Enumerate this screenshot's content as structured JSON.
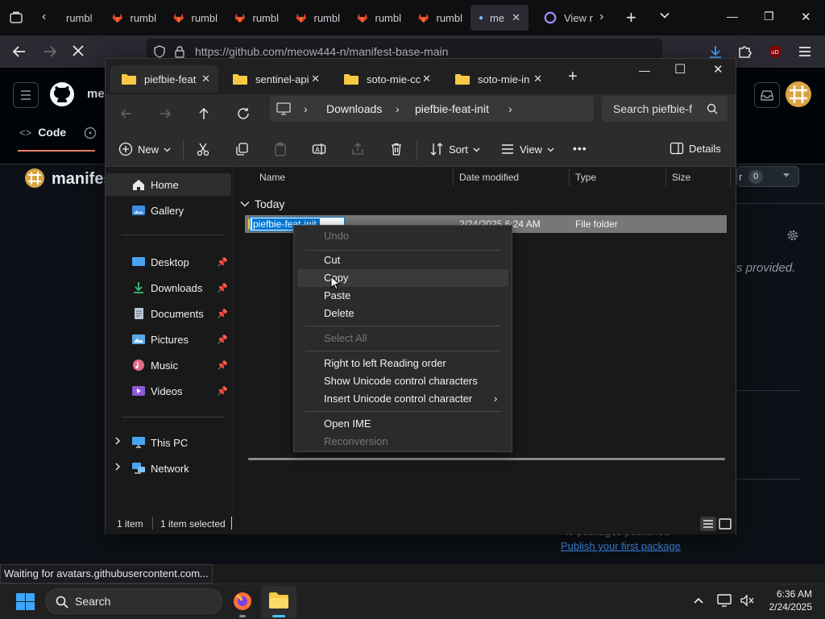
{
  "browser": {
    "tabs": [
      {
        "label": "rumbl",
        "active": false
      },
      {
        "label": "rumbl",
        "active": false
      },
      {
        "label": "rumbl",
        "active": false
      },
      {
        "label": "rumbl",
        "active": false
      },
      {
        "label": "rumbl",
        "active": false
      },
      {
        "label": "rumbl",
        "active": false
      },
      {
        "label": "rumbl",
        "active": false
      },
      {
        "label": "me",
        "active": true
      },
      {
        "label": "View r",
        "active": false
      }
    ],
    "url": "https://github.com/meow444-n/manifest-base-main",
    "close_tab_glyph": "✕",
    "new_tab_glyph": "+",
    "win_minimize": "—",
    "win_restore": "❐",
    "win_close": "✕"
  },
  "github": {
    "user_partial": "me",
    "code_tab": "Code",
    "repo_partial": "manifest",
    "counter_partial": "r",
    "counter_value": "0",
    "provided_text": "s provided.",
    "no_packages": "No packages published",
    "publish_link": "Publish your first package"
  },
  "explorer": {
    "tabs": [
      {
        "label": "piefbie-feat",
        "active": true
      },
      {
        "label": "sentinel-api",
        "active": false
      },
      {
        "label": "soto-mie-cc",
        "active": false
      },
      {
        "label": "soto-mie-in",
        "active": false
      }
    ],
    "tab_close_glyph": "✕",
    "new_tab_glyph": "+",
    "win_minimize": "—",
    "win_maximize": "☐",
    "win_close": "✕",
    "breadcrumb": [
      "Downloads",
      "piefbie-feat-init"
    ],
    "search_placeholder": "Search piefbie-f",
    "commands": {
      "new": "New",
      "sort": "Sort",
      "view": "View",
      "more": "•••",
      "details": "Details"
    },
    "nav": {
      "home": "Home",
      "gallery": "Gallery",
      "desktop": "Desktop",
      "downloads": "Downloads",
      "documents": "Documents",
      "pictures": "Pictures",
      "music": "Music",
      "videos": "Videos",
      "this_pc": "This PC",
      "network": "Network"
    },
    "columns": {
      "name": "Name",
      "date": "Date modified",
      "type": "Type",
      "size": "Size"
    },
    "group": "Today",
    "file": {
      "name_visible": "piefbie-feat-init",
      "date": "2/24/2025 6:24 AM",
      "type": "File folder"
    },
    "status": {
      "items": "1 item",
      "selected": "1 item selected"
    }
  },
  "context_menu": {
    "undo": "Undo",
    "cut": "Cut",
    "copy": "Copy",
    "paste": "Paste",
    "delete": "Delete",
    "select_all": "Select All",
    "rtl": "Right to left Reading order",
    "show_unicode": "Show Unicode control characters",
    "insert_unicode": "Insert Unicode control character",
    "open_ime": "Open IME",
    "reconversion": "Reconversion"
  },
  "status_tooltip": "Waiting for avatars.githubusercontent.com...",
  "taskbar": {
    "search": "Search",
    "time": "6:36 AM",
    "date": "2/24/2025"
  },
  "colors": {
    "accent": "#0078d4",
    "github_bg": "#0d1117",
    "explorer_bg": "#191919",
    "menu_bg": "#2b2b2b",
    "link_blue": "#4493f8"
  }
}
